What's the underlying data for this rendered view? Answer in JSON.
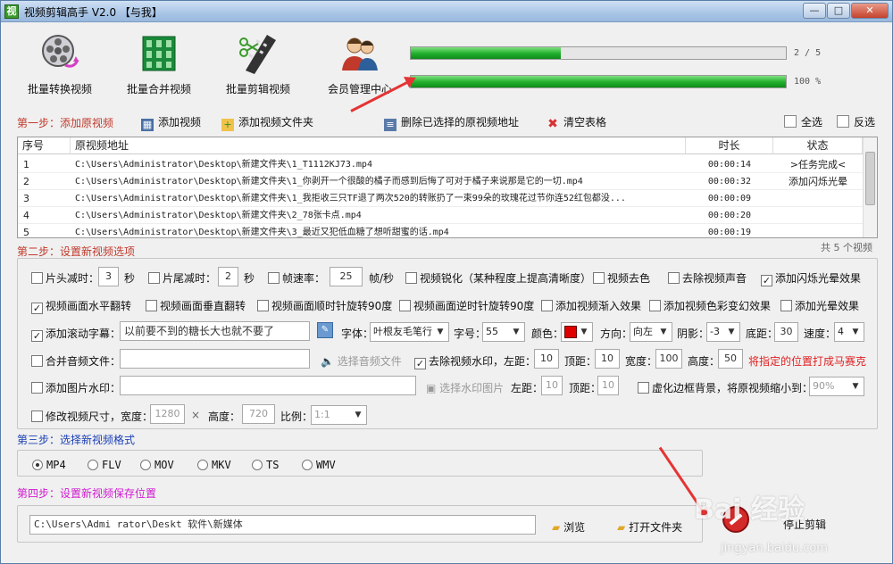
{
  "window": {
    "title": "视频剪辑高手 V2.0  【与我】",
    "app_icon": "film-app-icon"
  },
  "toolbar": {
    "items": [
      {
        "label": "批量转换视频",
        "icon": "film-reel-convert-icon"
      },
      {
        "label": "批量合并视频",
        "icon": "merge-grid-icon"
      },
      {
        "label": "批量剪辑视频",
        "icon": "film-scissors-icon"
      },
      {
        "label": "会员管理中心",
        "icon": "users-icon"
      }
    ]
  },
  "progress": [
    {
      "text": "2 / 5",
      "value": 0.4
    },
    {
      "text": "100 %",
      "value": 1.0
    }
  ],
  "step1": {
    "title": "第一步：添加原视频",
    "add_video": "添加视频",
    "add_folder": "添加视频文件夹",
    "delete_selected": "删除已选择的原视频地址",
    "clear_table": "清空表格",
    "select_all": "全选",
    "invert_select": "反选"
  },
  "table": {
    "headers": [
      "序号",
      "原视频地址",
      "时长",
      "状态"
    ],
    "rows": [
      {
        "no": "1",
        "path": "C:\\Users\\Administrator\\Desktop\\新建文件夹\\1_T1112KJ73.mp4",
        "duration": "00:00:14",
        "status": ">任务完成<"
      },
      {
        "no": "2",
        "path": "C:\\Users\\Administrator\\Desktop\\新建文件夹\\1_你剥开一个很酸的橘子而感到后悔了可对于橘子来说那是它的一切.mp4",
        "duration": "00:00:32",
        "status": "添加闪烁光晕"
      },
      {
        "no": "3",
        "path": "C:\\Users\\Administrator\\Desktop\\新建文件夹\\1_我拒收三只TF退了两次520的转账扔了一束99朵的玫瑰花过节你连52红包都没...",
        "duration": "00:00:09",
        "status": ""
      },
      {
        "no": "4",
        "path": "C:\\Users\\Administrator\\Desktop\\新建文件夹\\2_78张卡点.mp4",
        "duration": "00:00:20",
        "status": ""
      },
      {
        "no": "5",
        "path": "C:\\Users\\Administrator\\Desktop\\新建文件夹\\3_最近又犯低血糖了想听甜蜜的话.mp4",
        "duration": "00:00:19",
        "status": ""
      }
    ],
    "total": "共 5 个视频"
  },
  "step2": {
    "title": "第二步：设置新视频选项",
    "trim_head": {
      "label": "片头减时：",
      "value": "3",
      "unit": "秒"
    },
    "trim_tail": {
      "label": "片尾减时：",
      "value": "2",
      "unit": "秒"
    },
    "frame_rate": {
      "label": "帧速率：",
      "value": "25",
      "unit": "帧/秒"
    },
    "sharpen": "视频锐化（某种程度上提高清晰度）",
    "decolor": "视频去色",
    "remove_audio": "去除视频声音",
    "flash_glow": "添加闪烁光晕效果",
    "flip_h": "视频画面水平翻转",
    "flip_v": "视频画面垂直翻转",
    "rotate_cw": "视频画面顺时针旋转90度",
    "rotate_ccw": "视频画面逆时针旋转90度",
    "fade_in": "添加视频渐入效果",
    "color_change": "添加视频色彩变幻效果",
    "glow": "添加光晕效果",
    "subtitle": {
      "label": "添加滚动字幕：",
      "value": "以前要不到的糖长大也就不要了"
    },
    "font": {
      "label": "字体：",
      "value": "叶根友毛笔行"
    },
    "size": {
      "label": "字号：",
      "value": "55"
    },
    "color": {
      "label": "颜色：",
      "value": "#e00000"
    },
    "direction": {
      "label": "方向：",
      "value": "向左"
    },
    "shadow": {
      "label": "阴影：",
      "value": "-3"
    },
    "bottom": {
      "label": "底距：",
      "value": "30"
    },
    "speed": {
      "label": "速度：",
      "value": "4"
    },
    "merge_audio": {
      "label": "合并音频文件：",
      "button": "选择音频文件"
    },
    "remove_watermark": {
      "label": "去除视频水印，左距：",
      "left": "10",
      "top_label": "顶距：",
      "top": "10",
      "width_label": "宽度：",
      "width": "100",
      "height_label": "高度：",
      "height": "50",
      "note": "将指定的位置打成马赛克"
    },
    "image_watermark": {
      "label": "添加图片水印：",
      "button": "选择水印图片",
      "left_label": "左距：",
      "left": "10",
      "top_label": "顶距：",
      "top": "10"
    },
    "blur_bg": {
      "label": "虚化边框背景，将原视频缩小到：",
      "value": "90%"
    },
    "resize": {
      "label": "修改视频尺寸，宽度：",
      "width": "1280",
      "height_label": "高度：",
      "height": "720",
      "times": "×",
      "ratio_label": "比例：",
      "ratio": "1:1"
    }
  },
  "step3": {
    "title": "第三步：选择新视频格式",
    "formats": [
      "MP4",
      "FLV",
      "MOV",
      "MKV",
      "TS",
      "WMV"
    ],
    "selected": "MP4"
  },
  "step4": {
    "title": "第四步：设置新视频保存位置",
    "path": "C:\\Users\\Admi     rator\\Deskt     软件\\新媒体",
    "browse": "浏览",
    "open_folder": "打开文件夹",
    "stop": "停止剪辑"
  },
  "watermark": {
    "brand": "Bai 经验",
    "sub": "jingyan.baidu.com"
  }
}
